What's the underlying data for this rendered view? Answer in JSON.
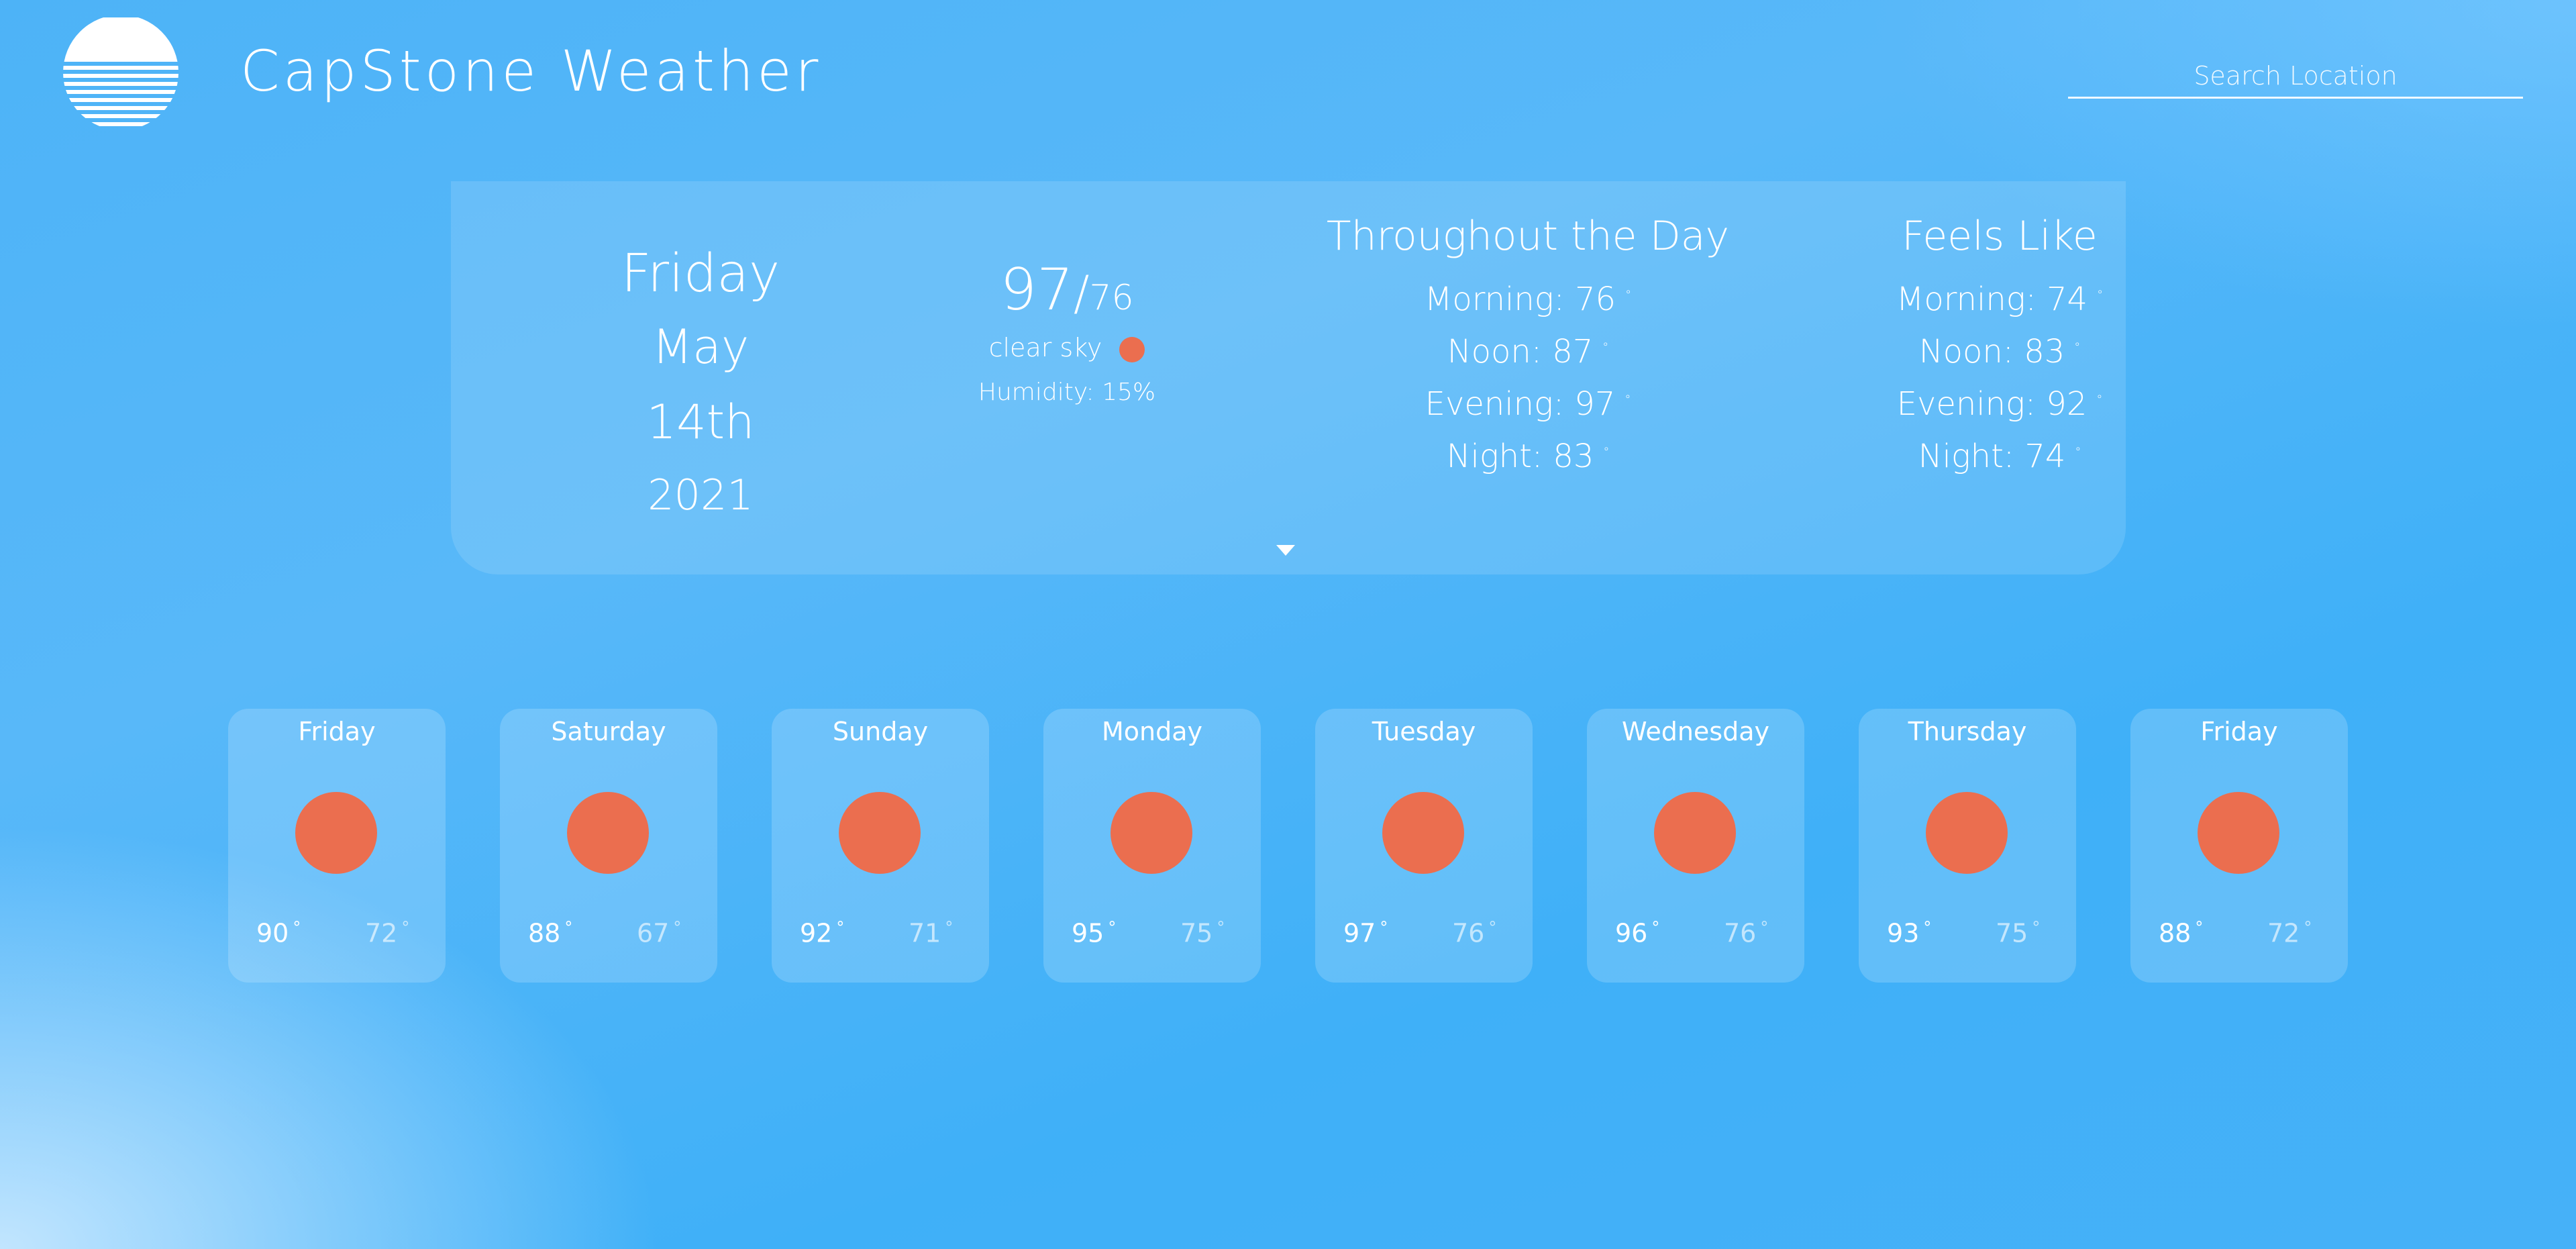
{
  "header": {
    "title": "CapStone Weather",
    "search_placeholder": "Search Location"
  },
  "current": {
    "day": "Friday",
    "date": "May 14th",
    "year": "2021",
    "high": "97",
    "low": "76",
    "condition": "clear sky",
    "humidity": "Humidity: 15%"
  },
  "throughout": {
    "title": "Throughout the Day",
    "items": [
      "Morning: 76",
      "Noon: 87",
      "Evening: 97",
      "Night: 83"
    ]
  },
  "feels": {
    "title": "Feels Like",
    "items": [
      "Morning: 74",
      "Noon: 83",
      "Evening: 92",
      "Night: 74"
    ]
  },
  "degree_symbol": "°",
  "forecast": [
    {
      "day": "Friday",
      "high": "90",
      "low": "72"
    },
    {
      "day": "Saturday",
      "high": "88",
      "low": "67"
    },
    {
      "day": "Sunday",
      "high": "92",
      "low": "71"
    },
    {
      "day": "Monday",
      "high": "95",
      "low": "75"
    },
    {
      "day": "Tuesday",
      "high": "97",
      "low": "76"
    },
    {
      "day": "Wednesday",
      "high": "96",
      "low": "76"
    },
    {
      "day": "Thursday",
      "high": "93",
      "low": "75"
    },
    {
      "day": "Friday",
      "high": "88",
      "low": "72"
    }
  ],
  "colors": {
    "sun": "#eb6e4f",
    "background": "#4db3f7"
  },
  "icons": {
    "logo": "sunset-stripes-icon",
    "condition": "sun-icon",
    "expand": "caret-down-icon"
  }
}
